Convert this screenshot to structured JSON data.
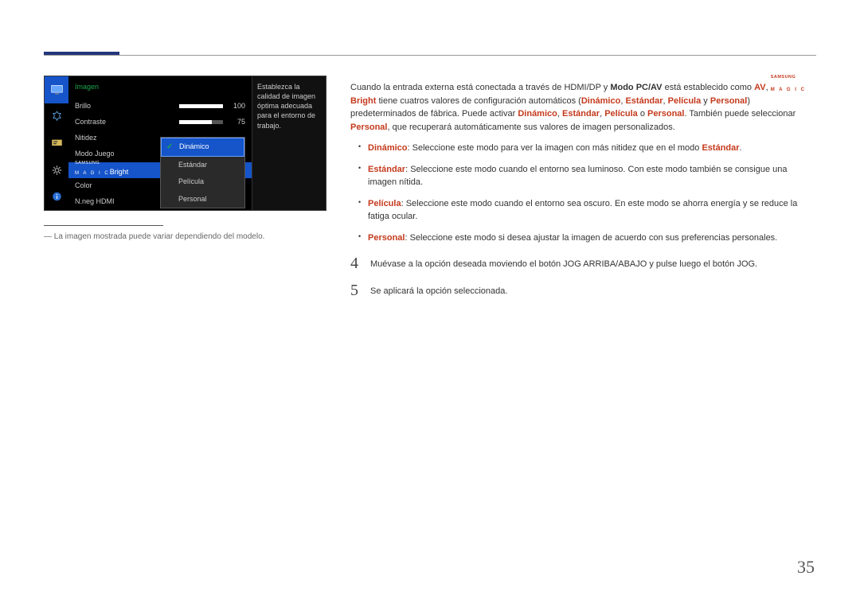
{
  "page_number": "35",
  "osd": {
    "title": "Imagen",
    "items": {
      "brillo": {
        "label": "Brillo",
        "value": "100"
      },
      "contraste": {
        "label": "Contraste",
        "value": "75"
      },
      "nitidez": {
        "label": "Nitidez"
      },
      "modo_juego": {
        "label": "Modo Juego"
      },
      "magic_top": "SAMSUNG",
      "magic_bottom": "M A G I C",
      "magic_suffix": "Bright",
      "color": {
        "label": "Color"
      },
      "nneg": {
        "label": "N.neg HDMI"
      }
    },
    "popup": {
      "dinamico": "Dinámico",
      "estandar": "Estándar",
      "pelicula": "Película",
      "personal": "Personal"
    },
    "desc": "Establezca la calidad de imagen óptima adecuada para el entorno de trabajo."
  },
  "footnote": "La imagen mostrada puede variar dependiendo del modelo.",
  "intro": {
    "p1a": "Cuando la entrada externa está conectada a través de HDMI/DP y ",
    "p1b": "Modo PC/AV",
    "p1c": " está establecido como ",
    "p1d": "AV",
    "magic_top": "SAMSUNG",
    "magic_bottom": "M A G I C",
    "magic_suffix": "Bright",
    "p1e": " tiene cuatros valores de configuración automáticos (",
    "p1f": "Dinámico",
    "p1g": "Estándar",
    "p1h": "Película",
    "p1i": " y ",
    "p1j": "Personal",
    "p1k": ") predeterminados de fábrica. Puede activar ",
    "p1l": "Dinámico",
    "p1m": "Estándar",
    "p1n": "Película",
    "p1o": " o ",
    "p1p": "Personal",
    "p1q": ". También puede seleccionar ",
    "p1r": "Personal",
    "p1s": ", que recuperará automáticamente sus valores de imagen personalizados."
  },
  "bullets": {
    "dinamico_l": "Dinámico",
    "dinamico_t": ": Seleccione este modo para ver la imagen con más nitidez que en el modo ",
    "dinamico_e": "Estándar",
    "dinamico_dot": ".",
    "estandar_l": "Estándar",
    "estandar_t": ": Seleccione este modo cuando el entorno sea luminoso. Con este modo también se consigue una imagen nítida.",
    "pelicula_l": "Película",
    "pelicula_t": ": Seleccione este modo cuando el entorno sea oscuro. En este modo se ahorra energía y se reduce la fatiga ocular.",
    "personal_l": "Personal",
    "personal_t": ": Seleccione este modo si desea ajustar la imagen de acuerdo con sus preferencias personales."
  },
  "steps": {
    "n4": "4",
    "t4": "Muévase a la opción deseada moviendo el botón JOG ARRIBA/ABAJO y pulse luego el botón JOG.",
    "n5": "5",
    "t5": "Se aplicará la opción seleccionada."
  }
}
